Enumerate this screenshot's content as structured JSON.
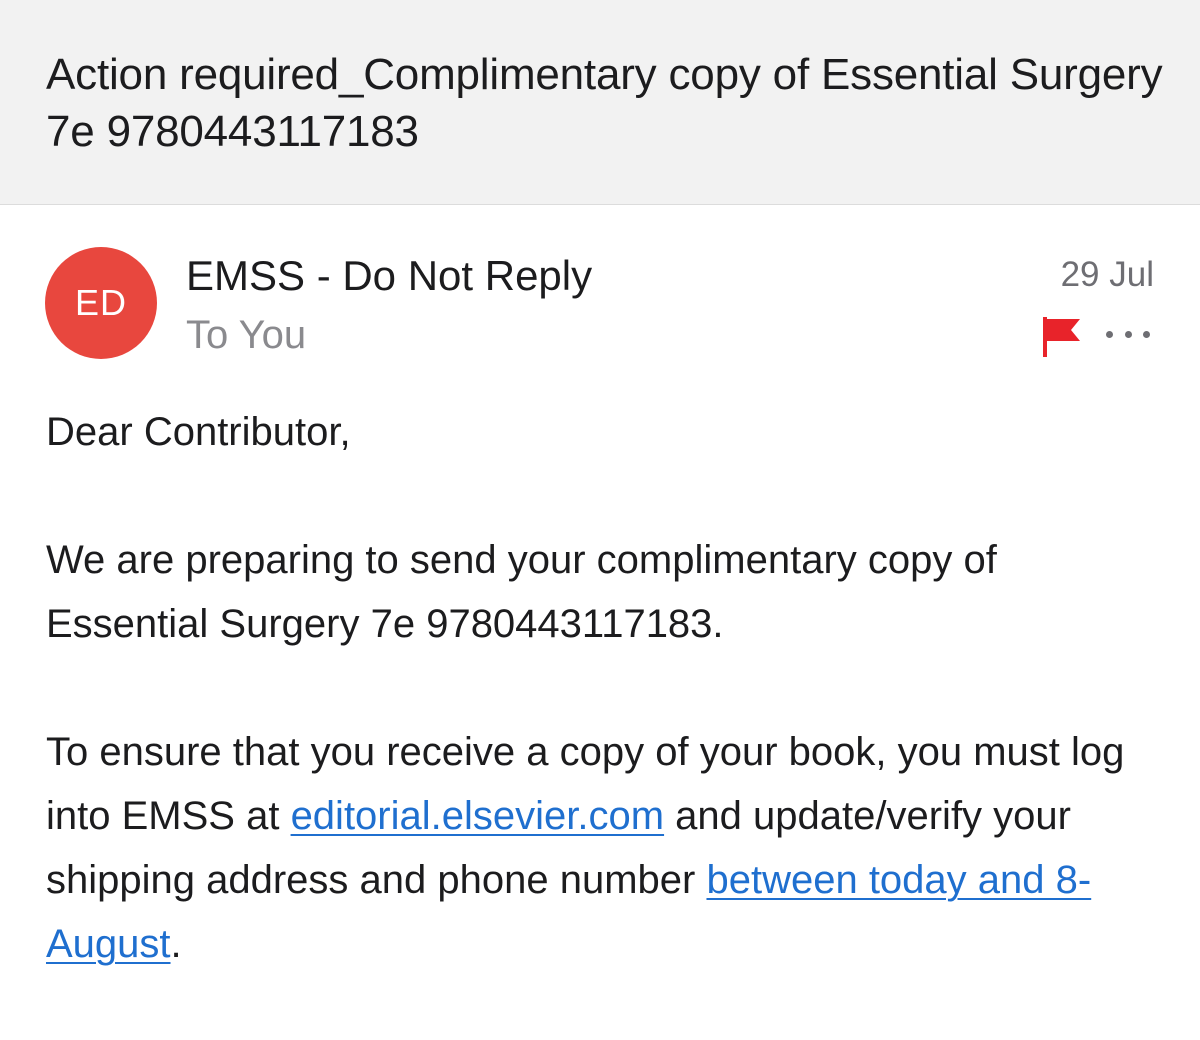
{
  "subject": "Action required_Complimentary copy of Essential Surgery 7e 9780443117183",
  "sender": {
    "initials": "ED",
    "name": "EMSS - Do Not Reply",
    "recipient": "To You",
    "avatar_color": "#e8473e"
  },
  "date": "29 Jul",
  "icons": {
    "flag": "flag-icon",
    "more": "more-options-icon",
    "flag_color": "#e8232a"
  },
  "body": {
    "greeting": "Dear Contributor,",
    "para1": "We are preparing to send your complimentary copy of Essential Surgery 7e 9780443117183.",
    "para2_part1": "To ensure that you receive a copy of your book, you must log into EMSS at ",
    "link1": "editorial.elsevier.com",
    "para2_part2": " and update/verify your shipping address and phone number ",
    "link2": "between today and 8-August",
    "para2_part3": "."
  },
  "link_color": "#1f6fcf"
}
